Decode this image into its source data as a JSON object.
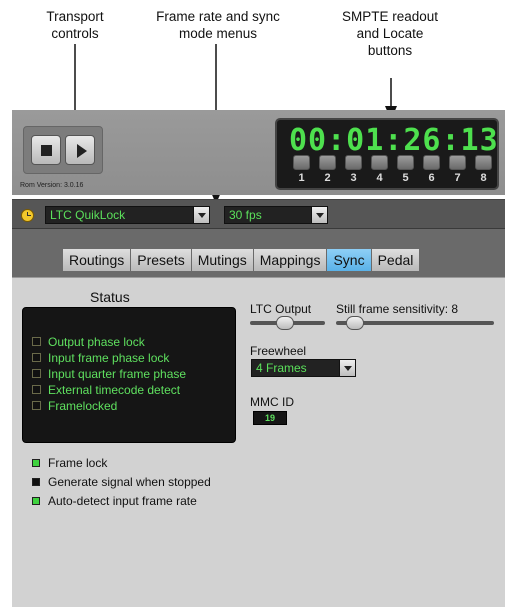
{
  "callouts": {
    "transport": [
      "Transport",
      "controls"
    ],
    "frame_rate": [
      "Frame rate and sync",
      "mode menus"
    ],
    "smpte": [
      "SMPTE readout",
      "and Locate",
      "buttons"
    ]
  },
  "header": {
    "rom_version": "Rom Version: 3.0.16",
    "smpte_time": "00:01:26:13",
    "locate_buttons": [
      "1",
      "2",
      "3",
      "4",
      "5",
      "6",
      "7",
      "8"
    ]
  },
  "transport": {
    "stop_icon": "stop-icon",
    "play_icon": "play-icon"
  },
  "selectors": {
    "sync_mode": "LTC QuikLock",
    "frame_rate": "30 fps"
  },
  "tabs": [
    {
      "label": "Routings",
      "active": false
    },
    {
      "label": "Presets",
      "active": false
    },
    {
      "label": "Mutings",
      "active": false
    },
    {
      "label": "Mappings",
      "active": false
    },
    {
      "label": "Sync",
      "active": true
    },
    {
      "label": "Pedal",
      "active": false
    }
  ],
  "status": {
    "title": "Status",
    "items": [
      "Output phase lock",
      "Input frame phase lock",
      "Input quarter frame phase",
      "External timecode detect",
      "Framelocked"
    ]
  },
  "indicators": [
    {
      "label": "Frame lock",
      "state": "green"
    },
    {
      "label": "Generate signal when stopped",
      "state": "dark"
    },
    {
      "label": "Auto-detect input frame rate",
      "state": "green"
    }
  ],
  "settings": {
    "ltc_output_label": "LTC Output",
    "still_frame_label": "Still frame sensitivity: 8",
    "freewheel_label": "Freewheel",
    "freewheel_value": "4 Frames",
    "mmc_id_label": "MMC ID",
    "mmc_id_value": "19"
  },
  "colors": {
    "readout_green": "#4ee04e",
    "active_tab_blue": "#5ab2e8",
    "clock_yellow": "#f3c82b"
  }
}
